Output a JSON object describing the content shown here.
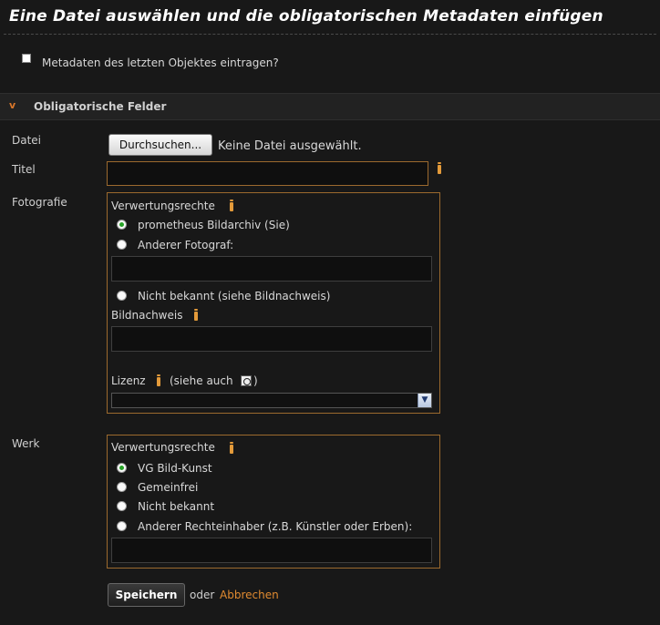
{
  "page": {
    "title": "Eine Datei auswählen und die obligatorischen Metadaten einfügen"
  },
  "copy_metadata": {
    "label": "Metadaten des letzten Objektes eintragen?",
    "checked": false
  },
  "section": {
    "title": "Obligatorische Felder",
    "chevron": "v"
  },
  "file": {
    "label": "Datei",
    "button": "Durchsuchen...",
    "status": "Keine Datei ausgewählt."
  },
  "title_field": {
    "label": "Titel",
    "value": ""
  },
  "photo": {
    "label": "Fotografie",
    "rights_label": "Verwertungsrechte",
    "options": [
      "prometheus Bildarchiv (Sie)",
      "Anderer Fotograf:",
      "Nicht bekannt (siehe Bildnachweis)"
    ],
    "selected": 0,
    "credit_label": "Bildnachweis",
    "license_label": "Lizenz",
    "license_see_prefix": "(siehe auch",
    "license_see_suffix": ")",
    "license_value": ""
  },
  "work": {
    "label": "Werk",
    "rights_label": "Verwertungsrechte",
    "options": [
      "VG Bild-Kunst",
      "Gemeinfrei",
      "Nicht bekannt",
      "Anderer Rechteinhaber (z.B. Künstler oder Erben):"
    ],
    "selected": 0
  },
  "actions": {
    "save": "Speichern",
    "or": "oder",
    "cancel": "Abbrechen"
  },
  "colors": {
    "accent": "#e08a30",
    "box_border": "#9c6a2e",
    "background": "#181818"
  }
}
